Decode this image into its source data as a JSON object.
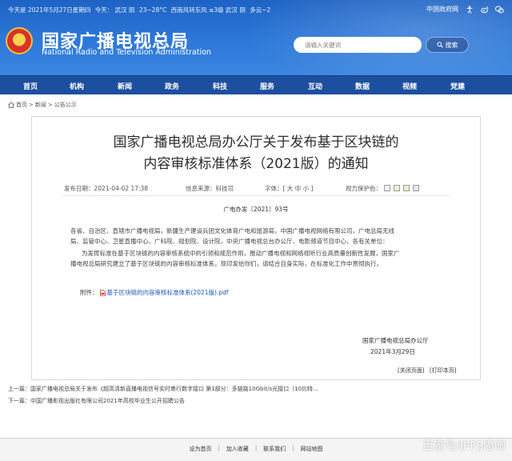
{
  "topbar": {
    "date_text": "今天是 2021年5月27日星期四",
    "weather_1": "今天： 武汉 阴",
    "temp_1": "23~28°C",
    "weather_2": "西南风转东风 ≤3级 武汉 阴",
    "temp_2": "多云~2",
    "gov_link": "中国政府网"
  },
  "brand": {
    "cn": "国家广播电视总局",
    "en": "National Radio and Television Administration"
  },
  "search": {
    "placeholder": "请输入关键词",
    "button": "搜索"
  },
  "nav": {
    "items": [
      "首页",
      "机构",
      "新闻",
      "政务",
      "科技",
      "服务",
      "互动",
      "数据",
      "视频",
      "党建"
    ]
  },
  "breadcrumb": {
    "items": [
      "首页",
      "新闻",
      "公告公示"
    ],
    "sep": ">"
  },
  "article": {
    "title_line1": "国家广播电视总局办公厅关于发布基于区块链的",
    "title_line2": "内容审核标准体系（2021版）的通知",
    "publish_time": "发布日期：2021-04-02 17:38",
    "source": "信息来源：科技司",
    "font_size": "字体：[ 大 中 小 ]",
    "eyes": "视力保护色：",
    "doc_no": "广电办发〔2021〕93号",
    "para1_line1": "各省、自治区、直辖市广播电视局，新疆生产建设兵团文化体育广电和旅游局，中国广播电视网络有限公司，广电总局无线",
    "para1_line2": "局、监管中心、卫星直播中心、广科院、规划院、设计院，中央广播电视总台办公厅、电影频道节目中心，各有关单位：",
    "para2_line1": "为发挥标准在基于区块链的内容审核系统中的引领和规范作用，推动广播电视和网络视听行业高质量创新性发展，国家广",
    "para2_line2": "播电视总局研究建立了基于区块链的内容审核标准体系。现印发给你们，请结合自身实际，在标准化工作中贯彻执行。",
    "attachment_label": "附件：",
    "attachment_name": "基于区块链的内容审核标准体系(2021版).pdf",
    "sign_org": "国家广播电视总局办公厅",
    "sign_date": "2021年3月29日",
    "close_page": "[关闭页面]",
    "print_page": "[打印本页]"
  },
  "prevnext": {
    "prev": "上一篇：国家广播电视总局关于发布《超高清新直播电视信号实时串行数字接口 第1部分：多链路10Gbit/s光接口（10比特...",
    "next": "下一篇：中国广播影视出版社有限公司2021年高校毕业生公开招聘公告"
  },
  "footer": {
    "links": [
      "设为首页",
      "加入收藏",
      "联系我们",
      "网站地图"
    ],
    "sep": "|"
  },
  "watermark": "百家号/IPFS嘟唧",
  "colors": {
    "header_blue": "#2d78d8",
    "nav_blue": "#1c4f9f",
    "link_blue": "#1a55b5"
  }
}
